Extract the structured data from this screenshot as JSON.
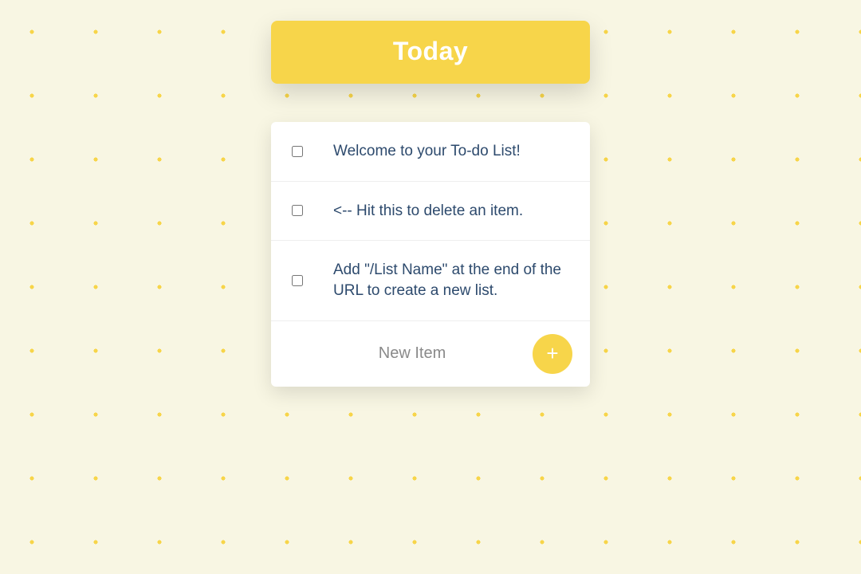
{
  "header": {
    "title": "Today"
  },
  "items": [
    {
      "text": "Welcome to your To-do List!"
    },
    {
      "text": "<-- Hit this to delete an item."
    },
    {
      "text": "Add \"/List Name\" at the end of the URL to create a new list."
    }
  ],
  "newItem": {
    "placeholder": "New Item",
    "addLabel": "+"
  }
}
